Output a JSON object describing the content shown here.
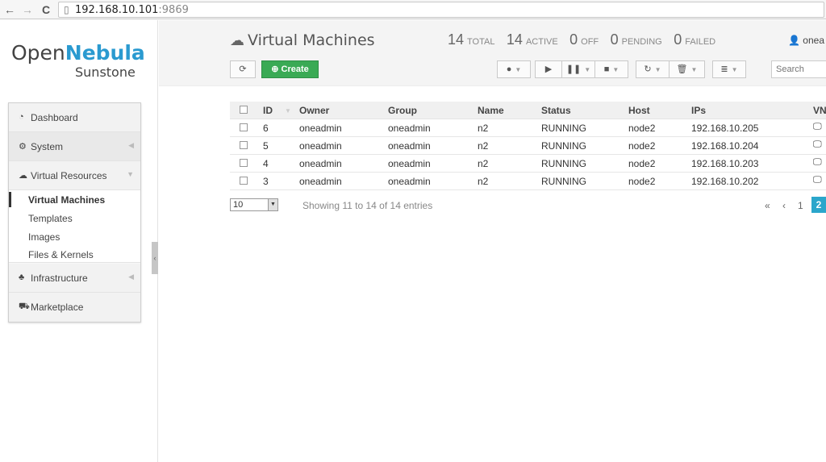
{
  "browser": {
    "back_icon": "←",
    "forward_icon": "→",
    "reload_icon": "C",
    "url_host": "192.168.10.101",
    "url_port": ":9869"
  },
  "sidebar": {
    "logo": {
      "brand_a": "Open",
      "brand_b": "Nebula",
      "brand_c": "Sunstone"
    },
    "items": [
      {
        "label": "Dashboard"
      },
      {
        "label": "System"
      },
      {
        "label": "Virtual Resources"
      },
      {
        "label": "Infrastructure"
      },
      {
        "label": "Marketplace"
      }
    ],
    "subitems": [
      {
        "label": "Virtual Machines"
      },
      {
        "label": "Templates"
      },
      {
        "label": "Images"
      },
      {
        "label": "Files & Kernels"
      }
    ]
  },
  "header": {
    "title": "Virtual Machines",
    "stats": [
      {
        "num": "14",
        "label": "TOTAL"
      },
      {
        "num": "14",
        "label": "ACTIVE"
      },
      {
        "num": "0",
        "label": "OFF"
      },
      {
        "num": "0",
        "label": "PENDING"
      },
      {
        "num": "0",
        "label": "FAILED"
      }
    ],
    "user": "onea"
  },
  "toolbar": {
    "create_label": "Create",
    "search_placeholder": "Search"
  },
  "table": {
    "headers": [
      "ID",
      "Owner",
      "Group",
      "Name",
      "Status",
      "Host",
      "IPs",
      "VN"
    ],
    "rows": [
      {
        "id": "6",
        "owner": "oneadmin",
        "group": "oneadmin",
        "name": "n2",
        "status": "RUNNING",
        "host": "node2",
        "ip": "192.168.10.205"
      },
      {
        "id": "5",
        "owner": "oneadmin",
        "group": "oneadmin",
        "name": "n2",
        "status": "RUNNING",
        "host": "node2",
        "ip": "192.168.10.204"
      },
      {
        "id": "4",
        "owner": "oneadmin",
        "group": "oneadmin",
        "name": "n2",
        "status": "RUNNING",
        "host": "node2",
        "ip": "192.168.10.203"
      },
      {
        "id": "3",
        "owner": "oneadmin",
        "group": "oneadmin",
        "name": "n2",
        "status": "RUNNING",
        "host": "node2",
        "ip": "192.168.10.202"
      }
    ]
  },
  "pager": {
    "page_size": "10",
    "showing": "Showing 11 to 14 of 14 entries",
    "first": "«",
    "prev": "‹",
    "page1": "1",
    "page2": "2"
  },
  "colors": {
    "accent": "#2a9ad0",
    "create": "#3aaa55",
    "active_page": "#2ba6cb"
  }
}
